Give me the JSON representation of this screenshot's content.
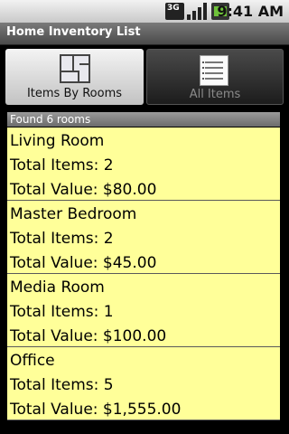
{
  "status_bar": {
    "network": "3G",
    "time": "9:41 AM"
  },
  "app": {
    "title": "Home Inventory List"
  },
  "tabs": [
    {
      "label": "Items By Rooms",
      "icon": "floorplan-icon",
      "selected": true
    },
    {
      "label": "All Items",
      "icon": "list-icon",
      "selected": false
    }
  ],
  "list": {
    "header": "Found 6 rooms",
    "rooms": [
      {
        "name": "Living Room",
        "total_items": "Total Items: 2",
        "total_value": "Total Value: $80.00"
      },
      {
        "name": "Master Bedroom",
        "total_items": "Total Items: 2",
        "total_value": "Total Value: $45.00"
      },
      {
        "name": "Media Room",
        "total_items": "Total Items: 1",
        "total_value": "Total Value: $100.00"
      },
      {
        "name": "Office",
        "total_items": "Total Items: 5",
        "total_value": "Total Value: $1,555.00"
      }
    ]
  },
  "colors": {
    "row_background": "#ffff99",
    "battery": "#6fc23a"
  }
}
